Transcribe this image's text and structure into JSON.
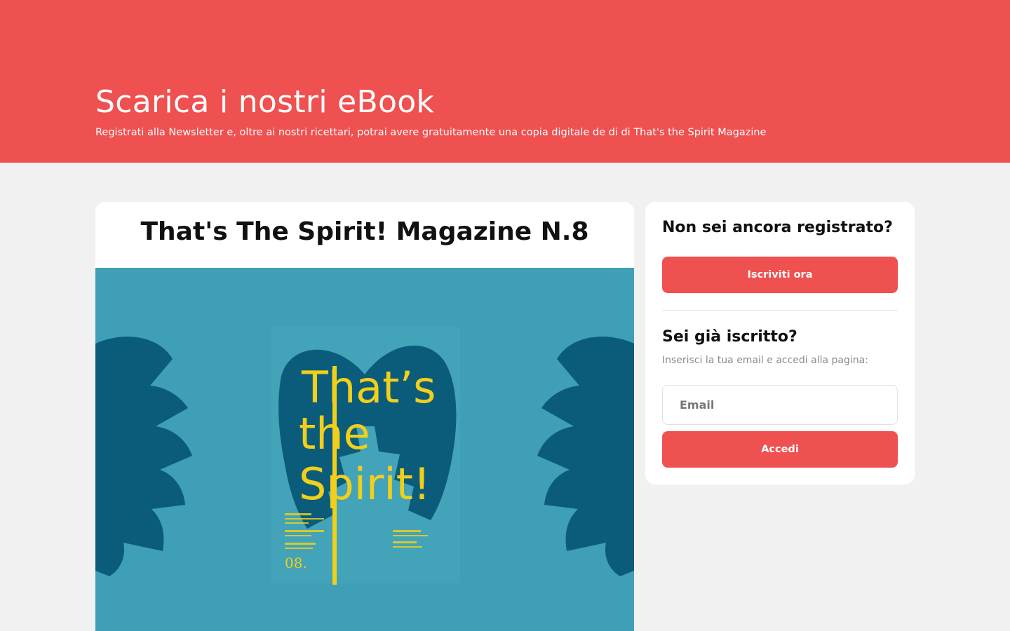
{
  "hero": {
    "title": "Scarica i nostri eBook",
    "subtitle": "Registrati alla Newsletter e, oltre ai nostri ricettari, potrai avere gratuitamente una copia digitale de di di That's the Spirit Magazine"
  },
  "ebook": {
    "title": "That's The Spirit! Magazine N.8",
    "cover": {
      "headline_lines": [
        "That’s",
        "the",
        "Spirit!"
      ],
      "issue": "08.",
      "background_color": "#3e9fb6",
      "leaf_color": "#0b5c7a",
      "text_color": "#f1cf1a"
    }
  },
  "signup": {
    "heading": "Non sei ancora registrato?",
    "cta_label": "Iscriviti ora"
  },
  "login": {
    "heading": "Sei già iscritto?",
    "hint": "Inserisci la tua email e accedi alla pagina:",
    "email_placeholder": "Email",
    "email_value": "",
    "submit_label": "Accedi"
  },
  "colors": {
    "accent": "#ef5050",
    "page_bg": "#f1f1f1",
    "card_bg": "#ffffff"
  }
}
